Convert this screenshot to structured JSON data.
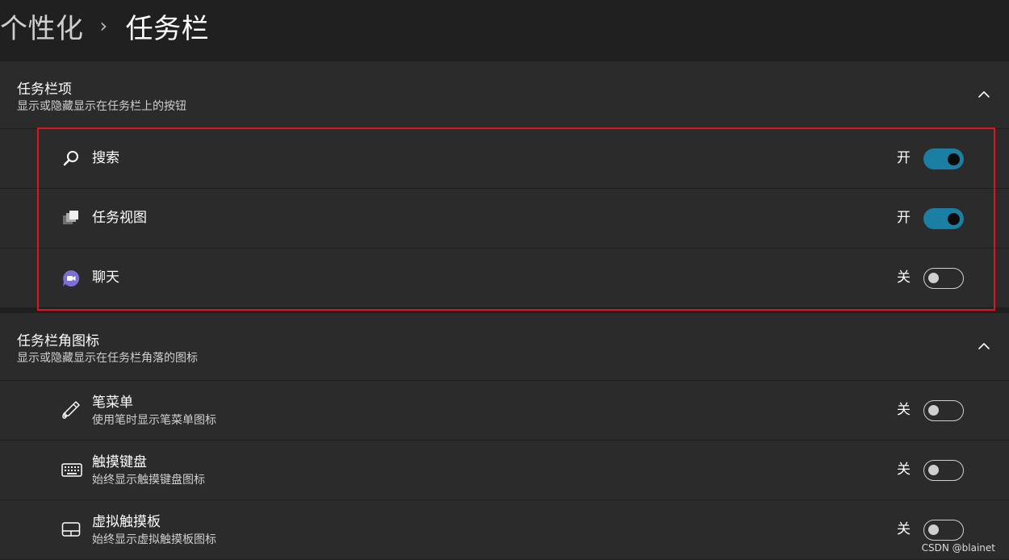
{
  "breadcrumb": {
    "parent": "个性化",
    "separator": "›",
    "current": "任务栏"
  },
  "sections": [
    {
      "title": "任务栏项",
      "subtitle": "显示或隐藏显示在任务栏上的按钮",
      "items": [
        {
          "label": "搜索",
          "state": "开",
          "on": true,
          "icon": "search-icon"
        },
        {
          "label": "任务视图",
          "state": "开",
          "on": true,
          "icon": "task-view-icon"
        },
        {
          "label": "聊天",
          "state": "关",
          "on": false,
          "icon": "chat-icon"
        }
      ]
    },
    {
      "title": "任务栏角图标",
      "subtitle": "显示或隐藏显示在任务栏角落的图标",
      "items": [
        {
          "label": "笔菜单",
          "description": "使用笔时显示笔菜单图标",
          "state": "关",
          "on": false,
          "icon": "pen-icon"
        },
        {
          "label": "触摸键盘",
          "description": "始终显示触摸键盘图标",
          "state": "关",
          "on": false,
          "icon": "keyboard-icon"
        },
        {
          "label": "虚拟触摸板",
          "description": "始终显示虚拟触摸板图标",
          "state": "关",
          "on": false,
          "icon": "touchpad-icon"
        }
      ]
    }
  ],
  "colors": {
    "accent": "#1b7fa3",
    "highlight_border": "#e0141f",
    "panel": "#2b2b2b",
    "background": "#202020"
  },
  "watermark": "CSDN @blainet"
}
